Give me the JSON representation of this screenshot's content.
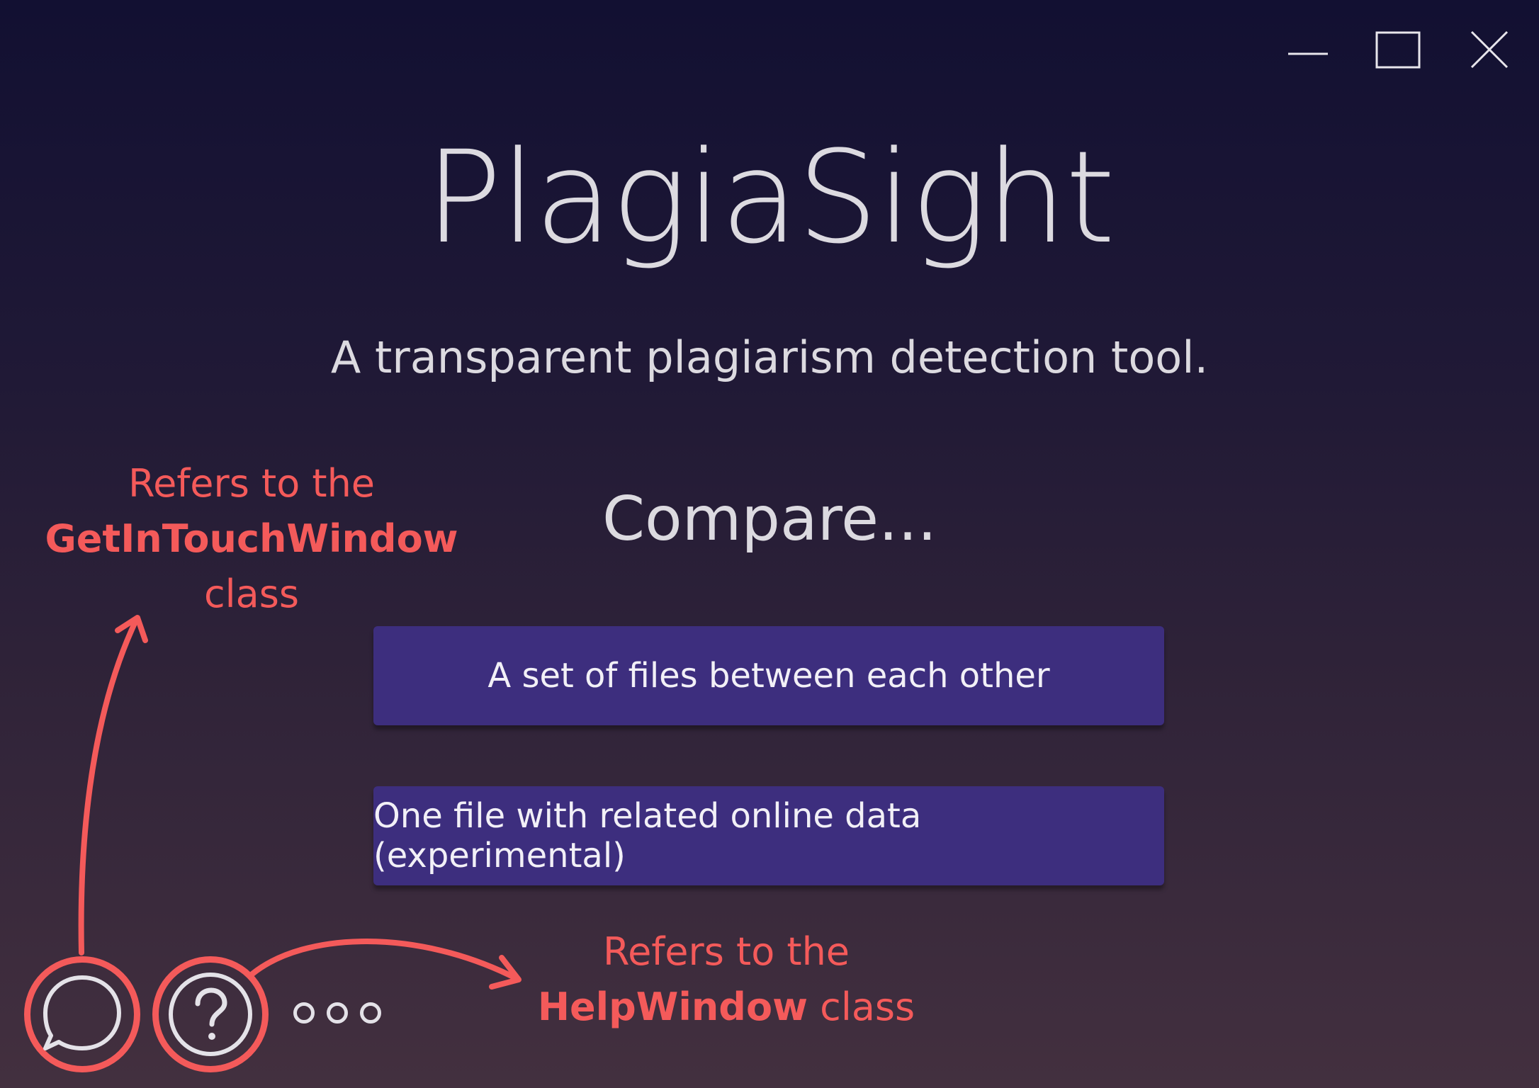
{
  "window": {
    "minimize_icon": "minimize-icon",
    "maximize_icon": "maximize-icon",
    "close_icon": "close-icon"
  },
  "app": {
    "title": "PlagiaSight",
    "subtitle": "A transparent plagiarism detection tool."
  },
  "compare": {
    "heading": "Compare...",
    "options": [
      {
        "label": "A set of files between each other"
      },
      {
        "label": "One file with related online data (experimental)"
      }
    ]
  },
  "footer": {
    "contact_icon": "chat-bubble-icon",
    "help_icon": "question-mark-icon",
    "more_icon": "more-dots-icon"
  },
  "annotations": {
    "contact": {
      "line1": "Refers to the",
      "class_name": "GetInTouchWindow",
      "line3": "class"
    },
    "help": {
      "line1": "Refers to the",
      "class_name": "HelpWindow",
      "suffix": "class"
    }
  },
  "colors": {
    "background_top": "#121032",
    "background_bottom": "#43303f",
    "button_bg": "#3d2e7e",
    "text": "#dcdae0",
    "annotation": "#f45a5a"
  }
}
